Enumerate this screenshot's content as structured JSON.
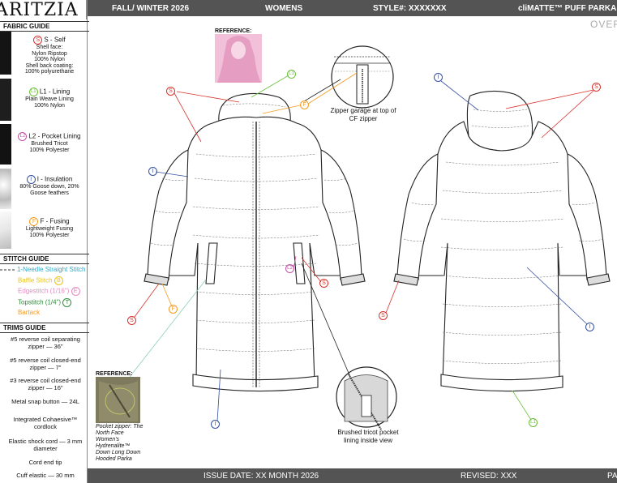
{
  "brand": "ARITZIA",
  "header": {
    "season": "FALL/ WINTER 2026",
    "division": "WOMENS",
    "style": "STYLE#: XXXXXXX",
    "product": "cliMATTE™ PUFF PARKA L"
  },
  "view_label": "OVER",
  "footer": {
    "issue_date": "ISSUE DATE: XX MONTH 2026",
    "revised": "REVISED: XXX",
    "page": "PA"
  },
  "fabric_guide": {
    "title": "FABRIC GUIDE",
    "items": [
      {
        "code": "S",
        "title": "S - Self",
        "lines": [
          "Shell face:",
          "Nylon Ripstop",
          "100% Nylon",
          "Shell back coating:",
          "100% polyurethane"
        ],
        "color": "#d9322b"
      },
      {
        "code": "L1",
        "title": "L1 - Lining",
        "lines": [
          "Plain Weave Lining",
          "100% Nylon"
        ],
        "color": "#6bbf3a"
      },
      {
        "code": "L2",
        "title": "L2 - Pocket Lining",
        "lines": [
          "Brushed Tricot",
          "100% Polyester"
        ],
        "color": "#c652a5"
      },
      {
        "code": "I",
        "title": "I - Insulation",
        "lines": [
          "80% Goose down, 20%",
          "Goose feathers"
        ],
        "color": "#3651a3"
      },
      {
        "code": "F",
        "title": "F - Fusing",
        "lines": [
          "Lightweight Fusing",
          "100% Polyester"
        ],
        "color": "#f39a1f"
      }
    ]
  },
  "stitch_guide": {
    "title": "STITCH GUIDE",
    "items": [
      {
        "label": "1-Needle Straight Stitch",
        "color": "#2ea9c8"
      },
      {
        "label": "Baffle Stitch",
        "code": "B",
        "color": "#e9c31a"
      },
      {
        "label": "Edgestitch (1/16\")",
        "code": "E",
        "color": "#e48ac0"
      },
      {
        "label": "Topstitch (1/4\")",
        "code": "T",
        "color": "#2e8b3a"
      },
      {
        "label": "Bartack",
        "color": "#f39a1f"
      }
    ]
  },
  "trims_guide": {
    "title": "TRIMS GUIDE",
    "items": [
      "#5 reverse coil separating zipper — 36\"",
      "#5 reverse coil closed-end zipper — 7\"",
      "#3 reverse coil closed-end zipper — 16\"",
      "Metal snap button — 24L",
      "Integrated Cohaesive™ cordlock",
      "Elastic shock cord — 3 mm diameter",
      "Cord end tip",
      "Cuff elastic — 30 mm"
    ]
  },
  "callouts": {
    "reference_top": "REFERENCE:",
    "zipper_garage": "Zipper garage at top of CF zipper",
    "reference_bottom": "REFERENCE:",
    "pocket_zipper_note": "Pocket zipper: The North Face Women's Hydrenalite™ Down Long Down Hooded Parka",
    "pocket_lining_note": "Brushed tricot pocket lining inside view"
  },
  "markers": {
    "S": "S",
    "L1": "L1",
    "L2": "L2",
    "I": "I",
    "F": "F"
  }
}
